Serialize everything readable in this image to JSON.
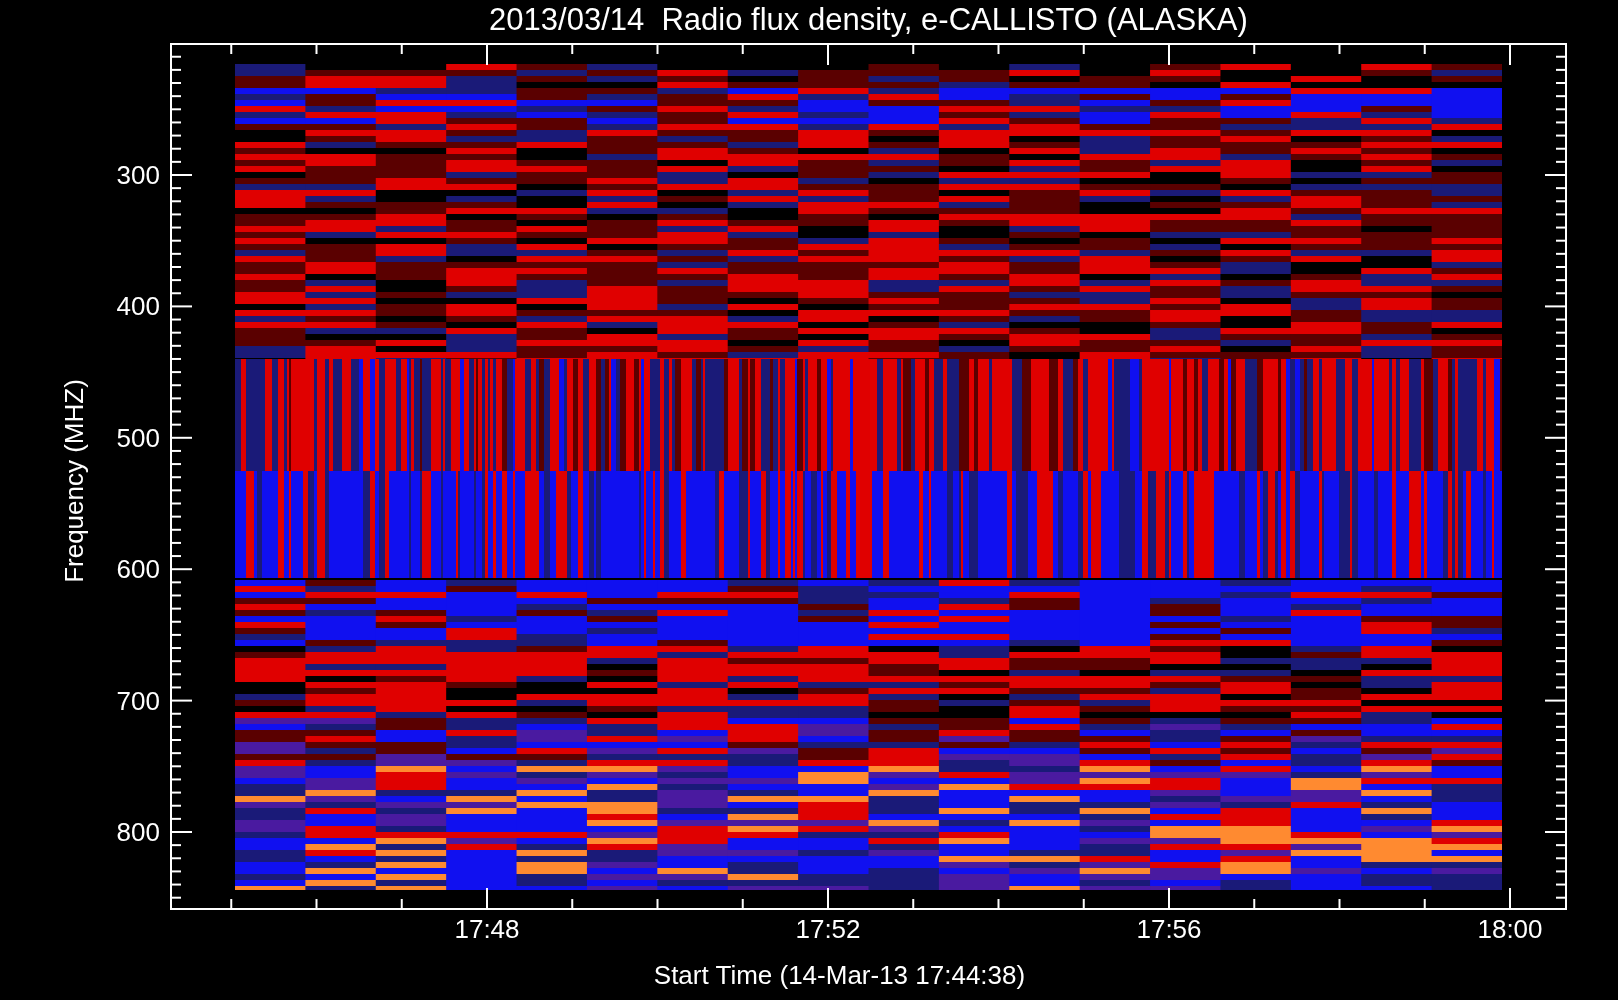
{
  "title": "2013/03/14  Radio flux density, e-CALLISTO (ALASKA)",
  "y_axis": {
    "label": "Frequency (MHZ)",
    "ticks": [
      "300",
      "400",
      "500",
      "600",
      "700",
      "800"
    ]
  },
  "x_axis": {
    "label": "Start Time (14-Mar-13 17:44:38)",
    "ticks": [
      "17:48",
      "17:52",
      "17:56",
      "18:00"
    ]
  }
}
